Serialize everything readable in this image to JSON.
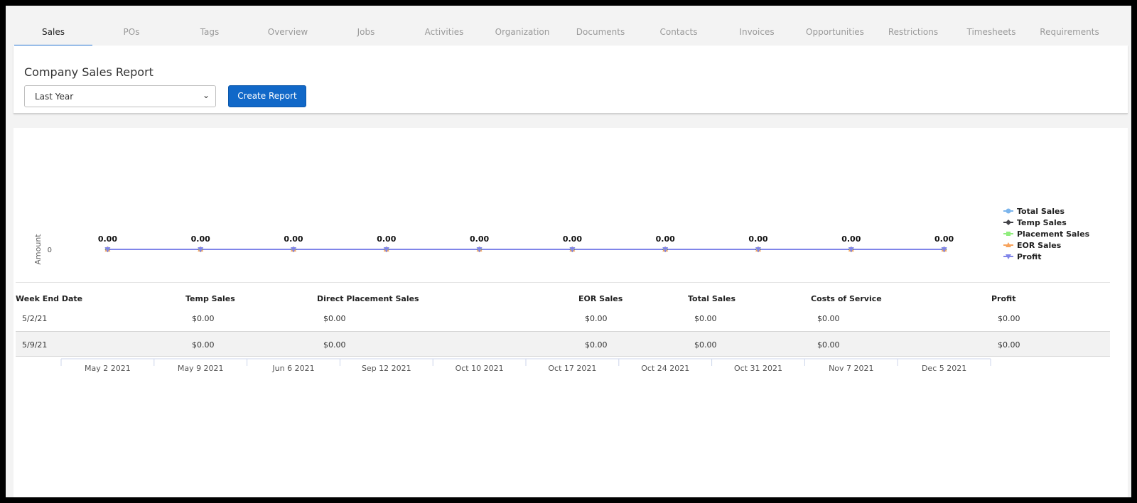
{
  "tabs": [
    "Sales",
    "POs",
    "Tags",
    "Overview",
    "Jobs",
    "Activities",
    "Organization",
    "Documents",
    "Contacts",
    "Invoices",
    "Opportunities",
    "Restrictions",
    "Timesheets",
    "Requirements"
  ],
  "report": {
    "title": "Company Sales Report",
    "period_value": "Last Year",
    "create_label": "Create Report"
  },
  "chart_data": {
    "type": "line",
    "ylabel": "Amount",
    "y_tick": "0",
    "categories": [
      "May 2 2021",
      "May 9 2021",
      "Jun 6 2021",
      "Sep 12 2021",
      "Oct 10 2021",
      "Oct 17 2021",
      "Oct 24 2021",
      "Oct 31 2021",
      "Nov 7 2021",
      "Dec 5 2021"
    ],
    "data_labels": [
      "0.00",
      "0.00",
      "0.00",
      "0.00",
      "0.00",
      "0.00",
      "0.00",
      "0.00",
      "0.00",
      "0.00"
    ],
    "legend_position": "right",
    "series": [
      {
        "name": "Total Sales",
        "color": "#7cb5ec",
        "marker": "circle",
        "values": [
          0,
          0,
          0,
          0,
          0,
          0,
          0,
          0,
          0,
          0
        ]
      },
      {
        "name": "Temp Sales",
        "color": "#434348",
        "marker": "diamond",
        "values": [
          0,
          0,
          0,
          0,
          0,
          0,
          0,
          0,
          0,
          0
        ]
      },
      {
        "name": "Placement Sales",
        "color": "#90ed7d",
        "marker": "square",
        "values": [
          0,
          0,
          0,
          0,
          0,
          0,
          0,
          0,
          0,
          0
        ]
      },
      {
        "name": "EOR Sales",
        "color": "#f7a35c",
        "marker": "triangle",
        "values": [
          0,
          0,
          0,
          0,
          0,
          0,
          0,
          0,
          0,
          0
        ]
      },
      {
        "name": "Profit",
        "color": "#8085e9",
        "marker": "triangle-down",
        "values": [
          0,
          0,
          0,
          0,
          0,
          0,
          0,
          0,
          0,
          0
        ]
      }
    ]
  },
  "table": {
    "headers": [
      "Week End Date",
      "Temp Sales",
      "Direct Placement Sales",
      "EOR Sales",
      "Total Sales",
      "Costs of Service",
      "Profit"
    ],
    "rows": [
      [
        "5/2/21",
        "$0.00",
        "$0.00",
        "$0.00",
        "$0.00",
        "$0.00",
        "$0.00"
      ],
      [
        "5/9/21",
        "$0.00",
        "$0.00",
        "$0.00",
        "$0.00",
        "$0.00",
        "$0.00"
      ]
    ]
  }
}
